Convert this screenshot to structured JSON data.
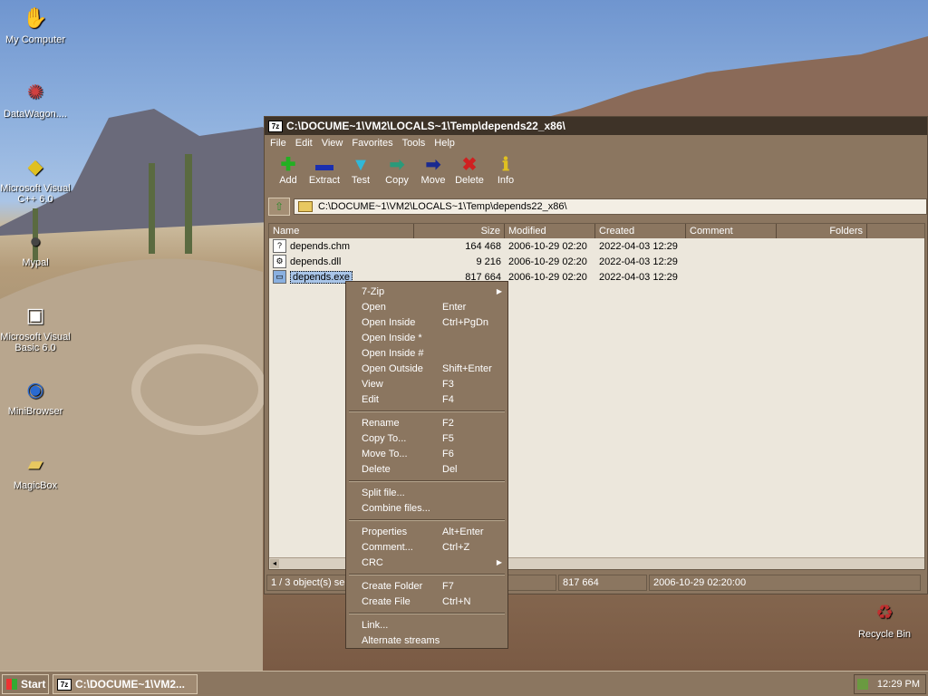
{
  "desktop": {
    "icons": [
      {
        "label": "My Computer"
      },
      {
        "label": "DataWagon...."
      },
      {
        "label": "Microsoft Visual C++ 6.0"
      },
      {
        "label": "Mypal"
      },
      {
        "label": "Microsoft Visual Basic 6.0"
      },
      {
        "label": "MiniBrowser"
      },
      {
        "label": "MagicBox"
      },
      {
        "label": "Recycle Bin"
      }
    ]
  },
  "window": {
    "title": "C:\\DOCUME~1\\VM2\\LOCALS~1\\Temp\\depends22_x86\\",
    "app_icon": "7z",
    "menu": [
      "File",
      "Edit",
      "View",
      "Favorites",
      "Tools",
      "Help"
    ],
    "toolbar": [
      {
        "label": "Add",
        "icon": "plus-icon",
        "color": "#22b022"
      },
      {
        "label": "Extract",
        "icon": "minus-icon",
        "color": "#1a2fb0"
      },
      {
        "label": "Test",
        "icon": "check-icon",
        "color": "#30b8d8"
      },
      {
        "label": "Copy",
        "icon": "arrow-right-icon",
        "color": "#2a9a7a"
      },
      {
        "label": "Move",
        "icon": "arrow-right-icon",
        "color": "#1a2a90"
      },
      {
        "label": "Delete",
        "icon": "x-icon",
        "color": "#d02020"
      },
      {
        "label": "Info",
        "icon": "info-icon",
        "color": "#e0c020"
      }
    ],
    "address": "C:\\DOCUME~1\\VM2\\LOCALS~1\\Temp\\depends22_x86\\",
    "columns": [
      "Name",
      "Size",
      "Modified",
      "Created",
      "Comment",
      "Folders"
    ],
    "files": [
      {
        "name": "depends.chm",
        "size": "164 468",
        "modified": "2006-10-29 02:20",
        "created": "2022-04-03 12:29"
      },
      {
        "name": "depends.dll",
        "size": "9 216",
        "modified": "2006-10-29 02:20",
        "created": "2022-04-03 12:29"
      },
      {
        "name": "depends.exe",
        "size": "817 664",
        "modified": "2006-10-29 02:20",
        "created": "2022-04-03 12:29"
      }
    ],
    "status": {
      "selection": "1 / 3 object(s) sel",
      "size": "817 664",
      "modified": "2006-10-29 02:20:00"
    }
  },
  "context_menu": {
    "groups": [
      [
        {
          "label": "7-Zip",
          "shortcut": "",
          "submenu": true
        },
        {
          "label": "Open",
          "shortcut": "Enter"
        },
        {
          "label": "Open Inside",
          "shortcut": "Ctrl+PgDn"
        },
        {
          "label": "Open Inside *",
          "shortcut": ""
        },
        {
          "label": "Open Inside #",
          "shortcut": ""
        },
        {
          "label": "Open Outside",
          "shortcut": "Shift+Enter"
        },
        {
          "label": "View",
          "shortcut": "F3"
        },
        {
          "label": "Edit",
          "shortcut": "F4"
        }
      ],
      [
        {
          "label": "Rename",
          "shortcut": "F2"
        },
        {
          "label": "Copy To...",
          "shortcut": "F5"
        },
        {
          "label": "Move To...",
          "shortcut": "F6"
        },
        {
          "label": "Delete",
          "shortcut": "Del"
        }
      ],
      [
        {
          "label": "Split file...",
          "shortcut": ""
        },
        {
          "label": "Combine files...",
          "shortcut": ""
        }
      ],
      [
        {
          "label": "Properties",
          "shortcut": "Alt+Enter"
        },
        {
          "label": "Comment...",
          "shortcut": "Ctrl+Z"
        },
        {
          "label": "CRC",
          "shortcut": "",
          "submenu": true
        }
      ],
      [
        {
          "label": "Create Folder",
          "shortcut": "F7"
        },
        {
          "label": "Create File",
          "shortcut": "Ctrl+N"
        }
      ],
      [
        {
          "label": "Link...",
          "shortcut": ""
        },
        {
          "label": "Alternate streams",
          "shortcut": ""
        }
      ]
    ]
  },
  "taskbar": {
    "start_label": "Start",
    "task_label": "C:\\DOCUME~1\\VM2...",
    "clock": "12:29 PM"
  }
}
